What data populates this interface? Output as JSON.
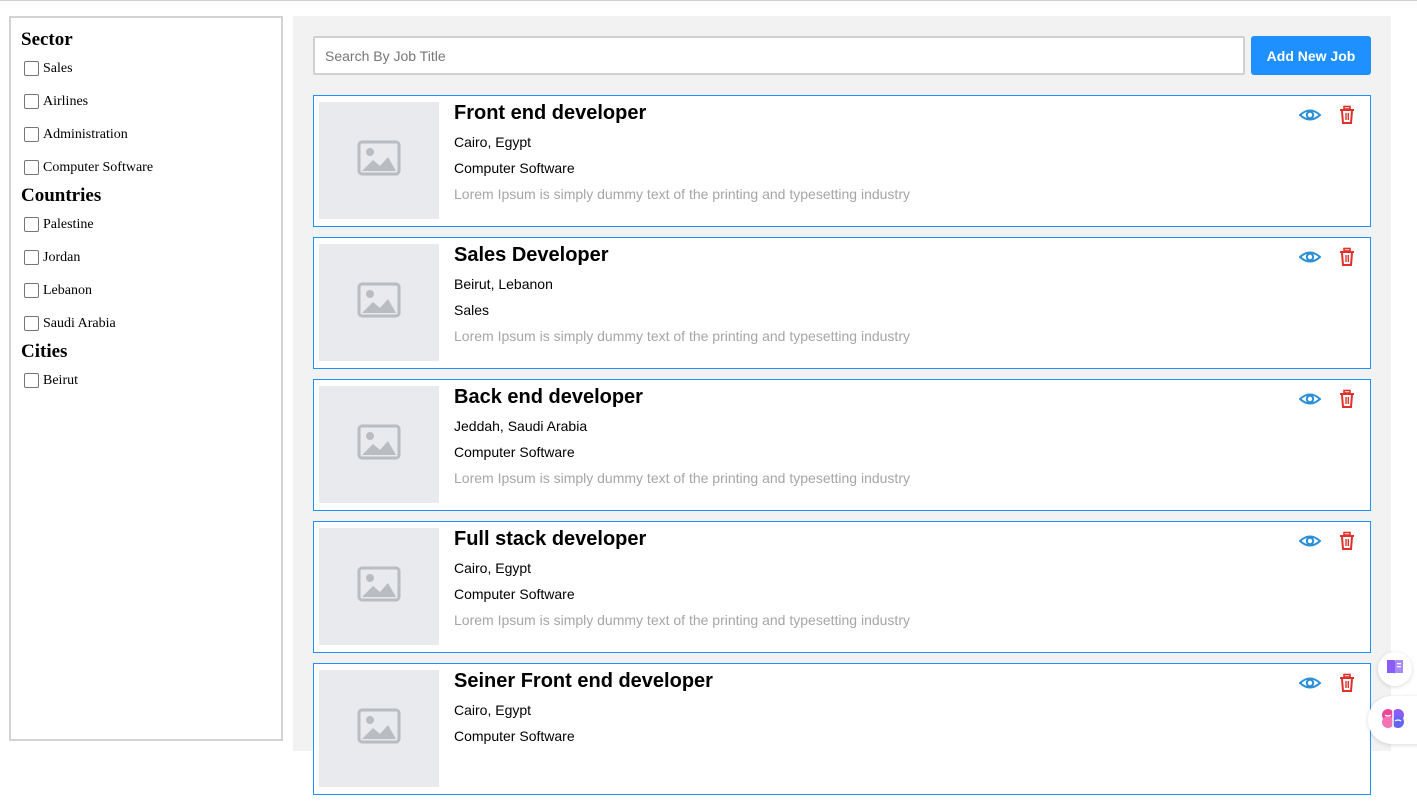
{
  "filters": [
    {
      "title": "Sector",
      "options": [
        "Sales",
        "Airlines",
        "Administration",
        "Computer Software"
      ]
    },
    {
      "title": "Countries",
      "options": [
        "Palestine",
        "Jordan",
        "Lebanon",
        "Saudi Arabia"
      ]
    },
    {
      "title": "Cities",
      "options": [
        "Beirut"
      ]
    }
  ],
  "search": {
    "placeholder": "Search By Job Title",
    "value": ""
  },
  "toolbar": {
    "add_label": "Add New Job"
  },
  "jobs": [
    {
      "title": "Front end developer",
      "location": "Cairo, Egypt",
      "sector": "Computer Software",
      "description": "Lorem Ipsum is simply dummy text of the printing and typesetting industry"
    },
    {
      "title": "Sales Developer",
      "location": "Beirut, Lebanon",
      "sector": "Sales",
      "description": "Lorem Ipsum is simply dummy text of the printing and typesetting industry"
    },
    {
      "title": "Back end developer",
      "location": "Jeddah, Saudi Arabia",
      "sector": "Computer Software",
      "description": "Lorem Ipsum is simply dummy text of the printing and typesetting industry"
    },
    {
      "title": "Full stack developer",
      "location": "Cairo, Egypt",
      "sector": "Computer Software",
      "description": "Lorem Ipsum is simply dummy text of the printing and typesetting industry"
    },
    {
      "title": "Seiner Front end developer",
      "location": "Cairo, Egypt",
      "sector": "Computer Software",
      "description": ""
    }
  ],
  "icons": {
    "view": "eye-icon",
    "delete": "trash-icon",
    "thumbnail": "image-placeholder-icon",
    "book": "book-icon",
    "brain": "brain-icon"
  },
  "colors": {
    "accent": "#1e90ff",
    "delete": "#e0302a",
    "view": "#2a8fd6",
    "description": "#a6a6a6",
    "main_bg": "#f2f2f2"
  }
}
